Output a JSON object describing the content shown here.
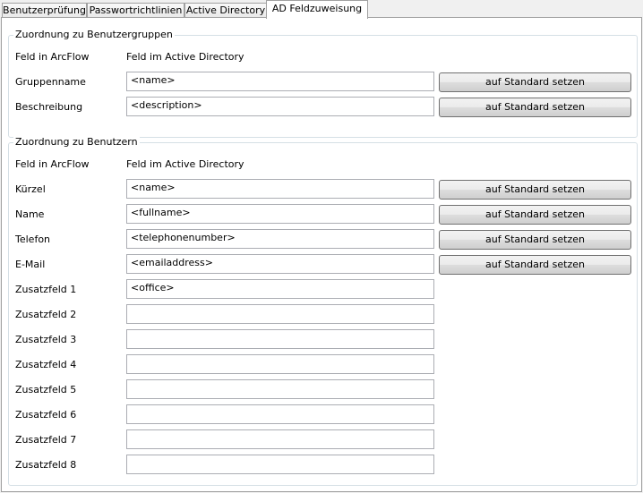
{
  "tabs": [
    {
      "label": "Benutzerprüfung"
    },
    {
      "label": "Passwortrichtlinien"
    },
    {
      "label": "Active Directory"
    },
    {
      "label": "AD Feldzuweisung"
    }
  ],
  "groups": {
    "label": "Zuordnung zu Benutzergruppen",
    "col_arcflow": "Feld in ArcFlow",
    "col_ad": "Feld im Active Directory",
    "rows": [
      {
        "label": "Gruppenname",
        "value": "<name>",
        "button": "auf Standard setzen"
      },
      {
        "label": "Beschreibung",
        "value": "<description>",
        "button": "auf Standard setzen"
      }
    ]
  },
  "users": {
    "label": "Zuordnung zu Benutzern",
    "col_arcflow": "Feld in ArcFlow",
    "col_ad": "Feld im Active Directory",
    "rows": [
      {
        "label": "Kürzel",
        "value": "<name>",
        "button": "auf Standard setzen"
      },
      {
        "label": "Name",
        "value": "<fullname>",
        "button": "auf Standard setzen"
      },
      {
        "label": "Telefon",
        "value": "<telephonenumber>",
        "button": "auf Standard setzen"
      },
      {
        "label": "E-Mail",
        "value": "<emailaddress>",
        "button": "auf Standard setzen"
      },
      {
        "label": "Zusatzfeld 1",
        "value": "<office>"
      },
      {
        "label": "Zusatzfeld 2",
        "value": ""
      },
      {
        "label": "Zusatzfeld 3",
        "value": ""
      },
      {
        "label": "Zusatzfeld 4",
        "value": ""
      },
      {
        "label": "Zusatzfeld 5",
        "value": ""
      },
      {
        "label": "Zusatzfeld 6",
        "value": ""
      },
      {
        "label": "Zusatzfeld 7",
        "value": ""
      },
      {
        "label": "Zusatzfeld 8",
        "value": ""
      }
    ]
  }
}
